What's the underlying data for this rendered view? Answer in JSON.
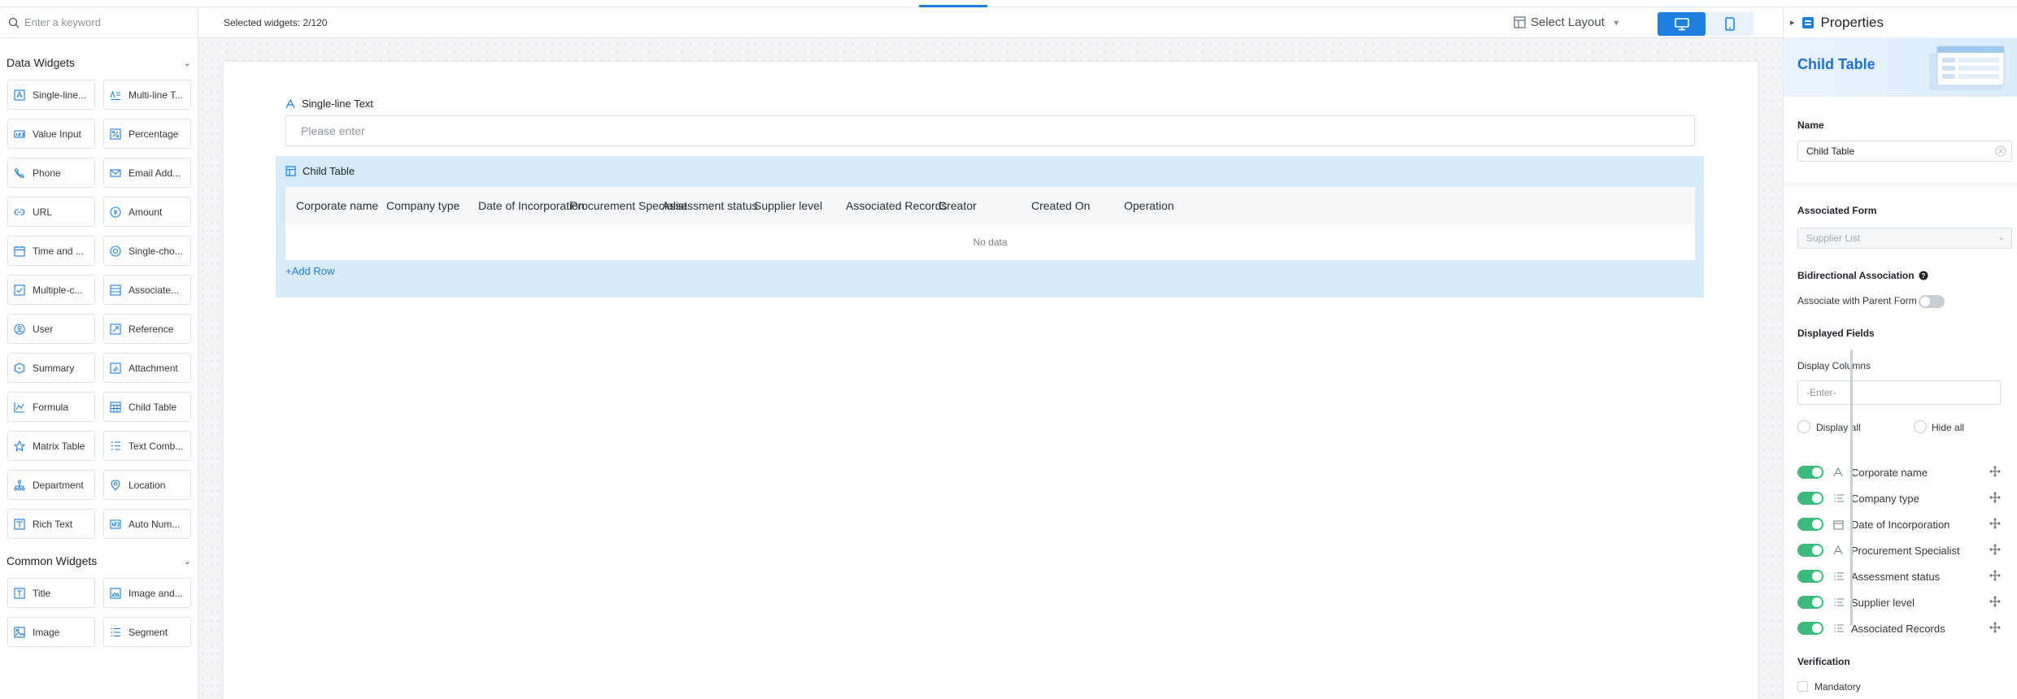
{
  "search": {
    "placeholder": "Enter a keyword"
  },
  "left": {
    "group1": "Data Widgets",
    "group2": "Common Widgets",
    "data_widgets": [
      {
        "label": "Single-line...",
        "icon": "text-icon"
      },
      {
        "label": "Multi-line T...",
        "icon": "multiline-text-icon"
      },
      {
        "label": "Value Input",
        "icon": "number-icon"
      },
      {
        "label": "Percentage",
        "icon": "percentage-icon"
      },
      {
        "label": "Phone",
        "icon": "phone-icon"
      },
      {
        "label": "Email Add...",
        "icon": "email-icon"
      },
      {
        "label": "URL",
        "icon": "link-icon"
      },
      {
        "label": "Amount",
        "icon": "amount-icon"
      },
      {
        "label": "Time and ...",
        "icon": "calendar-icon"
      },
      {
        "label": "Single-cho...",
        "icon": "radio-icon"
      },
      {
        "label": "Multiple-c...",
        "icon": "checkbox-icon"
      },
      {
        "label": "Associate...",
        "icon": "association-icon"
      },
      {
        "label": "User",
        "icon": "user-icon"
      },
      {
        "label": "Reference",
        "icon": "reference-icon"
      },
      {
        "label": "Summary",
        "icon": "summary-icon"
      },
      {
        "label": "Attachment",
        "icon": "attachment-icon"
      },
      {
        "label": "Formula",
        "icon": "formula-icon"
      },
      {
        "label": "Child Table",
        "icon": "table-icon"
      },
      {
        "label": "Matrix Table",
        "icon": "matrix-icon"
      },
      {
        "label": "Text Comb...",
        "icon": "text-combination-icon"
      },
      {
        "label": "Department",
        "icon": "department-icon"
      },
      {
        "label": "Location",
        "icon": "location-icon"
      },
      {
        "label": "Rich Text",
        "icon": "rich-text-icon"
      },
      {
        "label": "Auto Num...",
        "icon": "auto-number-icon"
      }
    ],
    "common_widgets": [
      {
        "label": "Title",
        "icon": "title-icon"
      },
      {
        "label": "Image and...",
        "icon": "image-text-icon"
      },
      {
        "label": "Image",
        "icon": "image-icon"
      },
      {
        "label": "Segment",
        "icon": "segment-icon"
      }
    ]
  },
  "toolbar": {
    "selected": "Selected widgets: 2/120",
    "layout": "Select Layout"
  },
  "form": {
    "single_line_label": "Single-line Text",
    "single_line_placeholder": "Please enter",
    "child_table_label": "Child Table",
    "columns": [
      "Corporate name",
      "Company type",
      "Date of Incorporation",
      "Procurement Specialist",
      "Assessment status",
      "Supplier level",
      "Associated Records",
      "Creator",
      "Created On",
      "Operation"
    ],
    "no_data": "No data",
    "add_row": "+Add Row"
  },
  "props": {
    "title": "Properties",
    "banner": "Child Table",
    "name_label": "Name",
    "name_value": "Child Table",
    "assoc_form_label": "Associated Form",
    "assoc_form_value": "Supplier List",
    "bidir_label": "Bidirectional Association",
    "assoc_parent": "Associate with Parent Form",
    "displayed_fields": "Displayed Fields",
    "display_columns": "Display Columns",
    "display_columns_placeholder": "-Enter-",
    "display_all": "Display all",
    "hide_all": "Hide all",
    "fields": [
      {
        "label": "Corporate name",
        "icon": "text-icon"
      },
      {
        "label": "Company type",
        "icon": "list-icon"
      },
      {
        "label": "Date of Incorporation",
        "icon": "calendar-icon"
      },
      {
        "label": "Procurement Specialist",
        "icon": "text-icon"
      },
      {
        "label": "Assessment status",
        "icon": "list-icon"
      },
      {
        "label": "Supplier level",
        "icon": "list-icon"
      },
      {
        "label": "Associated Records",
        "icon": "list-icon"
      }
    ],
    "verification": "Verification",
    "mandatory": "Mandatory"
  },
  "colors": {
    "accent": "#1d7fe0",
    "toggle_on": "#3cba7b",
    "child_bg": "#d7ebfb"
  }
}
